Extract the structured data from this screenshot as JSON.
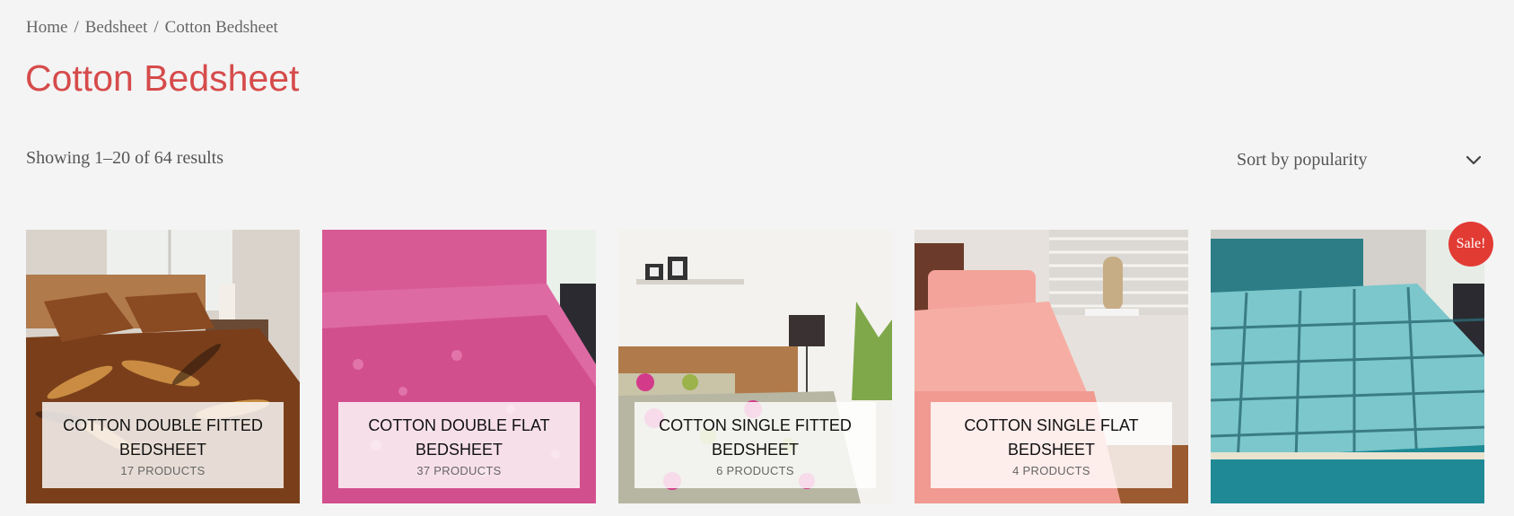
{
  "breadcrumb": {
    "home": "Home",
    "parent": "Bedsheet",
    "current": "Cotton Bedsheet",
    "sep": "/"
  },
  "page_title": "Cotton Bedsheet",
  "result_count": "Showing 1–20 of 64 results",
  "sort": {
    "selected": "Sort by popularity"
  },
  "sale_badge": "Sale!",
  "categories": [
    {
      "title": "COTTON DOUBLE FITTED BEDSHEET",
      "count": "17 PRODUCTS"
    },
    {
      "title": "COTTON DOUBLE FLAT BEDSHEET",
      "count": "37 PRODUCTS"
    },
    {
      "title": "COTTON SINGLE FITTED BEDSHEET",
      "count": "6 PRODUCTS"
    },
    {
      "title": "COTTON SINGLE FLAT BEDSHEET",
      "count": "4 PRODUCTS"
    }
  ],
  "colors": {
    "accent": "#d64b4b",
    "sale": "#e23b34",
    "background": "#f4f4f4"
  }
}
